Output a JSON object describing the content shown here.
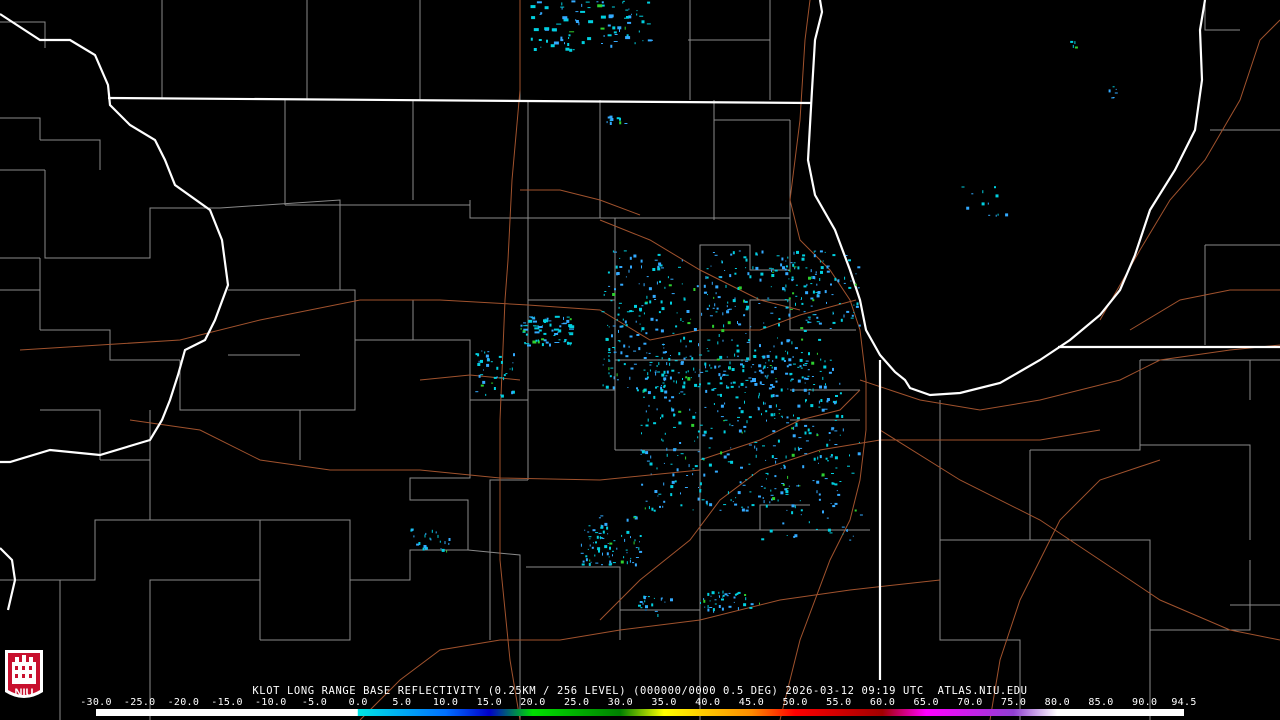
{
  "product_caption": "KLOT LONG RANGE BASE REFLECTIVITY (0.25KM / 256 LEVEL) (000000/0000 0.5 DEG) 2026-03-12 09:19 UTC  ATLAS.NIU.EDU",
  "logo_text": "NIU",
  "colorbar": {
    "tick_labels": [
      "-30.0",
      "-25.0",
      "-20.0",
      "-15.0",
      "-10.0",
      "-5.0",
      "0.0",
      "5.0",
      "10.0",
      "15.0",
      "20.0",
      "25.0",
      "30.0",
      "35.0",
      "40.0",
      "45.0",
      "50.0",
      "55.0",
      "60.0",
      "65.0",
      "70.0",
      "75.0",
      "80.0",
      "85.0",
      "90.0",
      "94.5"
    ],
    "min": -30,
    "max": 94.5,
    "stops": [
      {
        "dbz": -30,
        "color": "#ffffff"
      },
      {
        "dbz": -0.1,
        "color": "#ffffff"
      },
      {
        "dbz": 0,
        "color": "#00e5e5"
      },
      {
        "dbz": 10,
        "color": "#0070ff"
      },
      {
        "dbz": 15,
        "color": "#0000c8"
      },
      {
        "dbz": 20,
        "color": "#00e000"
      },
      {
        "dbz": 30,
        "color": "#008000"
      },
      {
        "dbz": 35,
        "color": "#ffff00"
      },
      {
        "dbz": 45,
        "color": "#ff8c00"
      },
      {
        "dbz": 50,
        "color": "#ff0000"
      },
      {
        "dbz": 60,
        "color": "#a00000"
      },
      {
        "dbz": 65,
        "color": "#ff00ff"
      },
      {
        "dbz": 75,
        "color": "#9040d0"
      },
      {
        "dbz": 80,
        "color": "#ffffff"
      },
      {
        "dbz": 94.5,
        "color": "#ffffff"
      }
    ]
  },
  "colors": {
    "background": "#000000",
    "state_border": "#ffffff",
    "county_border": "#8a8a8a",
    "highway": "#a0522d",
    "shoreline": "#ffffff",
    "logo_red": "#c8102e",
    "echo_primary": "#33aaff",
    "echo_secondary": "#00d0e0",
    "echo_strong": "#2ed02e"
  }
}
